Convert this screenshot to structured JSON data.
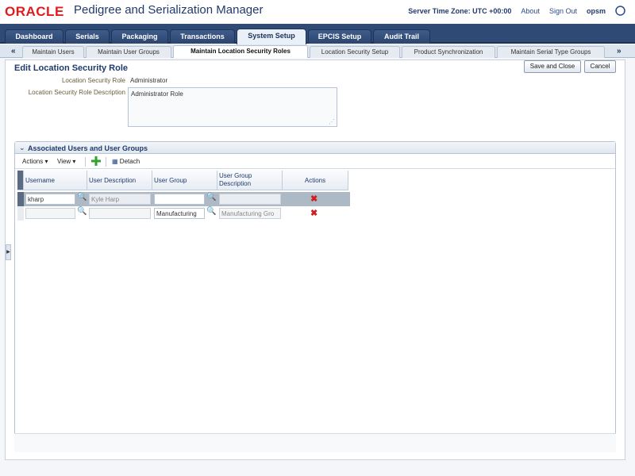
{
  "header": {
    "logo": "ORACLE",
    "app_title": "Pedigree and Serialization Manager",
    "server_time": "Server Time Zone: UTC +00:00",
    "about": "About",
    "sign_out": "Sign Out",
    "user": "opsm"
  },
  "main_tabs": [
    {
      "label": "Dashboard"
    },
    {
      "label": "Serials"
    },
    {
      "label": "Packaging"
    },
    {
      "label": "Transactions"
    },
    {
      "label": "System Setup"
    },
    {
      "label": "EPCIS Setup"
    },
    {
      "label": "Audit Trail"
    }
  ],
  "sub_tabs": [
    {
      "label": "Maintain Users"
    },
    {
      "label": "Maintain User Groups"
    },
    {
      "label": "Maintain Location Security Roles"
    },
    {
      "label": "Location Security Setup"
    },
    {
      "label": "Product Synchronization"
    },
    {
      "label": "Maintain Serial Type Groups"
    }
  ],
  "page": {
    "title": "Edit Location Security Role",
    "save_close": "Save and Close",
    "cancel": "Cancel",
    "role_label": "Location Security Role",
    "role_value": "Administrator",
    "desc_label": "Location Security Role Description",
    "desc_value": "Administrator Role"
  },
  "section": {
    "title": "Associated Users and User Groups",
    "toolbar": {
      "actions": "Actions",
      "view": "View",
      "detach": "Detach"
    },
    "columns": [
      "Username",
      "User Description",
      "User Group",
      "User Group Description",
      "Actions"
    ],
    "rows": [
      {
        "username": "kharp",
        "user_description": "Kyle Harp",
        "user_group": "",
        "group_description": ""
      },
      {
        "username": "",
        "user_description": "",
        "user_group": "Manufacturing",
        "group_description": "Manufacturing Gro"
      }
    ]
  },
  "colors": {
    "brand_red": "#e21b1b",
    "nav_blue": "#2f4a74",
    "delete_red": "#d01e1e"
  }
}
